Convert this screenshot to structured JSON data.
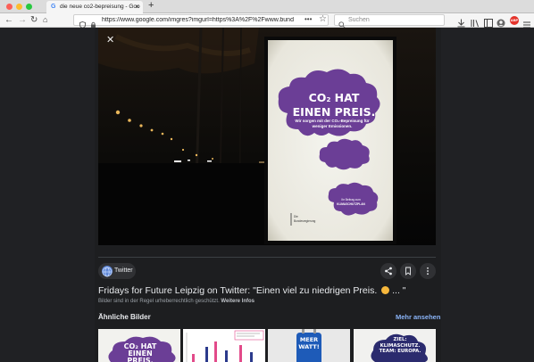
{
  "browser": {
    "tab_title": "die neue co2-bepreisung - Goo",
    "tab_favicon": "G",
    "url": "https://www.google.com/imgres?imgurl=https%3A%2F%2Fwww.bund",
    "search_placeholder": "Suchen",
    "abp_badge": "ABP"
  },
  "image_view": {
    "poster": {
      "headline_line1": "CO",
      "headline_sub": "2",
      "headline_line1_rest": " HAT",
      "headline_line2": "EINEN PREIS.",
      "subline1": "Wir sorgen mit der CO₂-Bepreisung für",
      "subline2": "weniger Emissionen.",
      "small_cloud_line1": "Ihr Beitrag zum",
      "small_cloud_line2": "KLIMASCHUTZPLAN",
      "ministry_line1": "Die",
      "ministry_line2": "Bundesregierung"
    },
    "source_label": "Twitter",
    "caption": "Fridays for Future Leipzig on Twitter: \"Einen viel zu niedrigen Preis.",
    "caption_tail": "... \"",
    "copyright": "Bilder sind in der Regel urheberrechtlich geschützt.",
    "more_info": "Weitere Infos"
  },
  "similar": {
    "heading": "Ähnliche Bilder",
    "more_link": "Mehr ansehen",
    "thumbs": [
      {
        "line1": "CO₂ HAT",
        "line2": "EINEN PREIS."
      },
      {
        "label": "chart"
      },
      {
        "line1": "MEER",
        "line2": "WATT!"
      },
      {
        "line1": "ZIEL:",
        "line2": "KLIMASCHUTZ.",
        "line3": "TEAM: EUROPA."
      }
    ]
  },
  "colors": {
    "accent_link": "#8ab4f8",
    "poster_purple": "#6b3e96",
    "dark_bg": "#202124"
  }
}
